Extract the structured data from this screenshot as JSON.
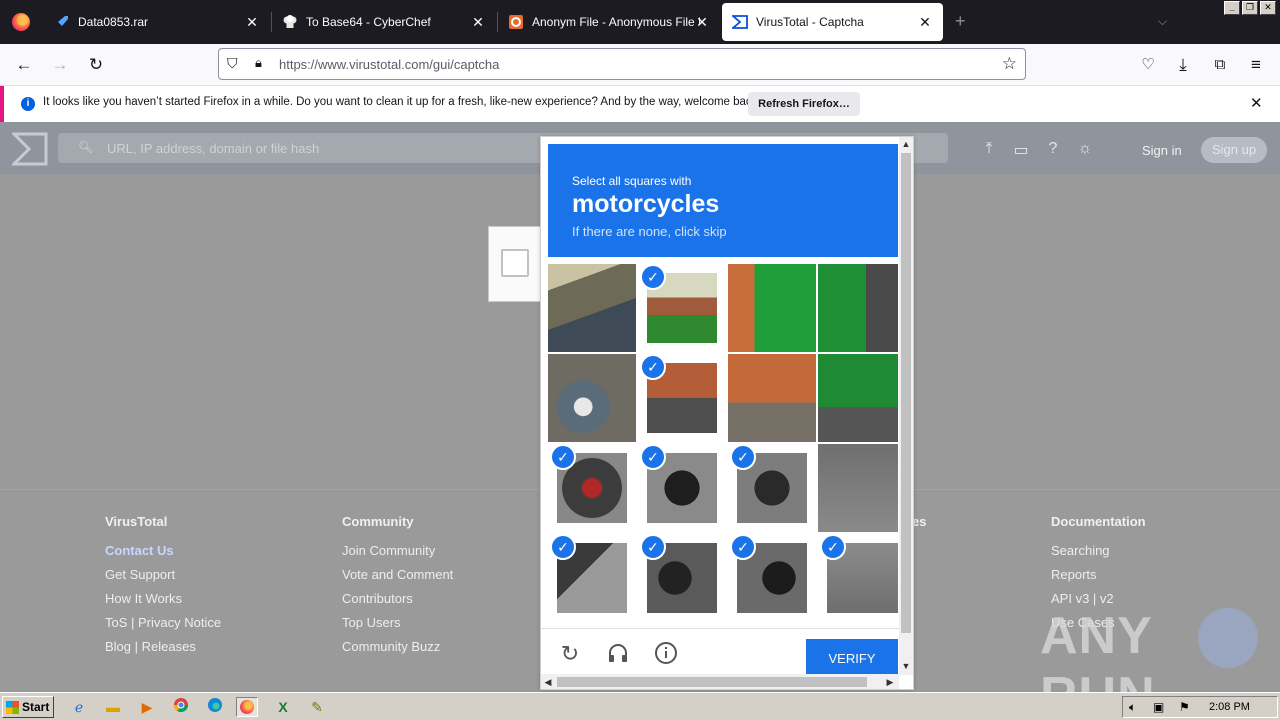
{
  "browser": {
    "tabs": [
      {
        "title": "Data0853.rar",
        "active": false
      },
      {
        "title": "To Base64 - CyberChef",
        "active": false
      },
      {
        "title": "Anonym File - Anonymous File Uplo",
        "active": false
      },
      {
        "title": "VirusTotal - Captcha",
        "active": true
      }
    ],
    "url": "https://www.virustotal.com/gui/captcha",
    "notification": {
      "text": "It looks like you haven’t started Firefox in a while. Do you want to clean it up for a fresh, like-new experience? And by the way, welcome back!",
      "button": "Refresh Firefox…"
    }
  },
  "site": {
    "search_placeholder": "URL, IP address, domain or file hash",
    "sign_in": "Sign in",
    "sign_up": "Sign up"
  },
  "captcha": {
    "instruction": "Select all squares with",
    "target": "motorcycles",
    "hint": "If there are none, click skip",
    "verify_label": "VERIFY",
    "accent": "#1a73e8"
  },
  "footer": {
    "columns": [
      {
        "heading": "VirusTotal",
        "links": [
          "Contact Us",
          "Get Support",
          "How It Works",
          "ToS | Privacy Notice",
          "Blog | Releases"
        ]
      },
      {
        "heading": "Community",
        "links": [
          "Join Community",
          "Vote and Comment",
          "Contributors",
          "Top Users",
          "Community Buzz"
        ]
      },
      {
        "heading": "es",
        "links": []
      },
      {
        "heading": "Documentation",
        "links": [
          "Searching",
          "Reports",
          "API v3 | v2",
          "Use Cases"
        ]
      }
    ]
  },
  "watermark": "ANY RUN",
  "taskbar": {
    "start_label": "Start",
    "clock": "2:08 PM"
  }
}
